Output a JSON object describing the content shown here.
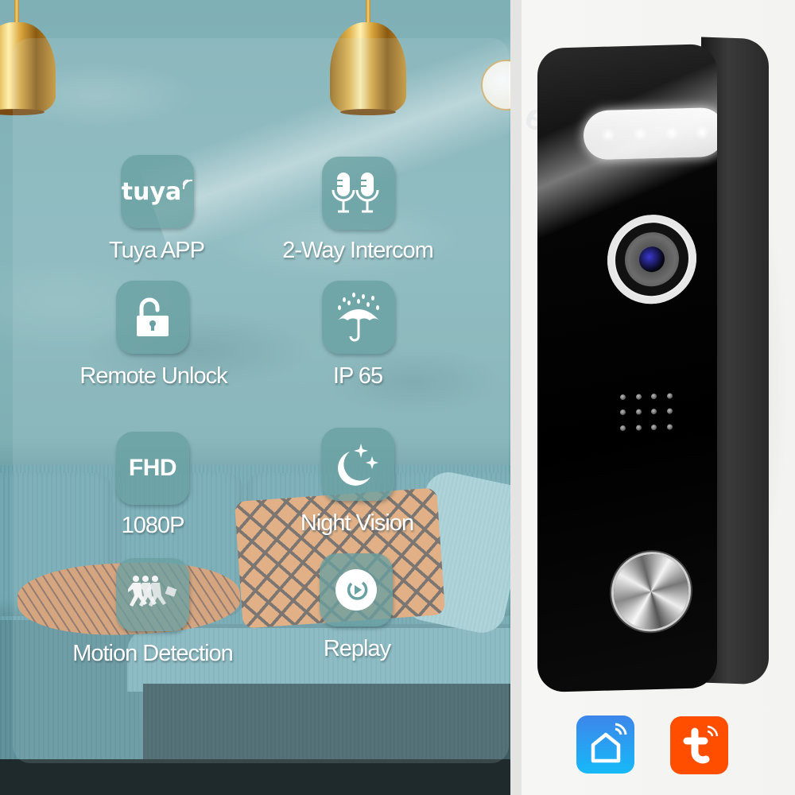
{
  "features": [
    {
      "id": "tuya-app",
      "label": "Tuya APP",
      "tile_text": "tuya",
      "icon": "tuya-logo-icon"
    },
    {
      "id": "two-way-intercom",
      "label": "2-Way Intercom",
      "icon": "microphones-icon"
    },
    {
      "id": "remote-unlock",
      "label": "Remote Unlock",
      "icon": "unlocked-padlock-icon"
    },
    {
      "id": "ip65",
      "label": "IP 65",
      "icon": "umbrella-rain-icon"
    },
    {
      "id": "fhd",
      "label": "1080P",
      "tile_text": "FHD",
      "icon": "fhd-text-icon"
    },
    {
      "id": "night-vision",
      "label": "Night Vision",
      "icon": "moon-stars-icon"
    },
    {
      "id": "motion-detection",
      "label": "Motion Detection",
      "icon": "running-figures-icon"
    },
    {
      "id": "replay",
      "label": "Replay",
      "icon": "replay-play-icon"
    }
  ],
  "product": {
    "name": "video-doorbell",
    "speaker_holes": 12
  },
  "apps": [
    {
      "name": "Smart Life",
      "icon": "smart-life-home-icon",
      "color": "#2a9df4"
    },
    {
      "name": "Tuya",
      "icon": "tuya-t-icon",
      "color": "#ff4e00"
    }
  ],
  "colors": {
    "tile": "#69a0a2",
    "tuya_orange": "#ff4e00",
    "smart_life_blue": "#2a9df4"
  }
}
